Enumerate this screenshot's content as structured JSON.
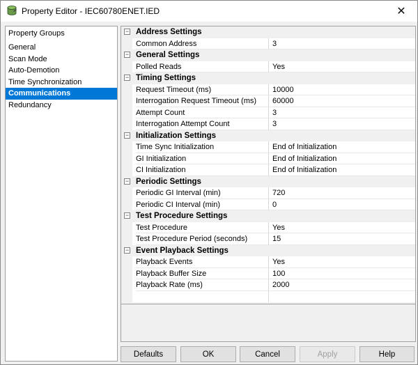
{
  "window": {
    "title": "Property Editor - IEC60780ENET.IED",
    "close_glyph": "✕",
    "icon": "database-icon"
  },
  "groups": {
    "header": "Property Groups",
    "items": [
      {
        "label": "General",
        "selected": false
      },
      {
        "label": "Scan Mode",
        "selected": false
      },
      {
        "label": "Auto-Demotion",
        "selected": false
      },
      {
        "label": "Time Synchronization",
        "selected": false
      },
      {
        "label": "Communications",
        "selected": true
      },
      {
        "label": "Redundancy",
        "selected": false
      }
    ]
  },
  "grid": {
    "categories": [
      {
        "name": "Address Settings",
        "properties": [
          {
            "name": "Common Address",
            "value": "3"
          }
        ]
      },
      {
        "name": "General Settings",
        "properties": [
          {
            "name": "Polled Reads",
            "value": "Yes"
          }
        ]
      },
      {
        "name": "Timing Settings",
        "properties": [
          {
            "name": "Request Timeout (ms)",
            "value": "10000"
          },
          {
            "name": "Interrogation Request Timeout (ms)",
            "value": "60000"
          },
          {
            "name": "Attempt Count",
            "value": "3"
          },
          {
            "name": "Interrogation Attempt Count",
            "value": "3"
          }
        ]
      },
      {
        "name": "Initialization Settings",
        "properties": [
          {
            "name": "Time Sync Initialization",
            "value": "End of Initialization"
          },
          {
            "name": "GI Initialization",
            "value": "End of Initialization"
          },
          {
            "name": "CI Initialization",
            "value": "End of Initialization"
          }
        ]
      },
      {
        "name": "Periodic Settings",
        "properties": [
          {
            "name": "Periodic GI Interval (min)",
            "value": "720"
          },
          {
            "name": "Periodic CI Interval (min)",
            "value": "0"
          }
        ]
      },
      {
        "name": "Test Procedure Settings",
        "properties": [
          {
            "name": "Test Procedure",
            "value": "Yes"
          },
          {
            "name": "Test Procedure Period (seconds)",
            "value": "15"
          }
        ]
      },
      {
        "name": "Event Playback Settings",
        "properties": [
          {
            "name": "Playback Events",
            "value": "Yes"
          },
          {
            "name": "Playback Buffer Size",
            "value": "100"
          },
          {
            "name": "Playback Rate (ms)",
            "value": "2000"
          }
        ]
      }
    ],
    "collapse_glyph": "−"
  },
  "buttons": {
    "defaults": "Defaults",
    "ok": "OK",
    "cancel": "Cancel",
    "apply": "Apply",
    "help": "Help",
    "apply_enabled": false
  }
}
